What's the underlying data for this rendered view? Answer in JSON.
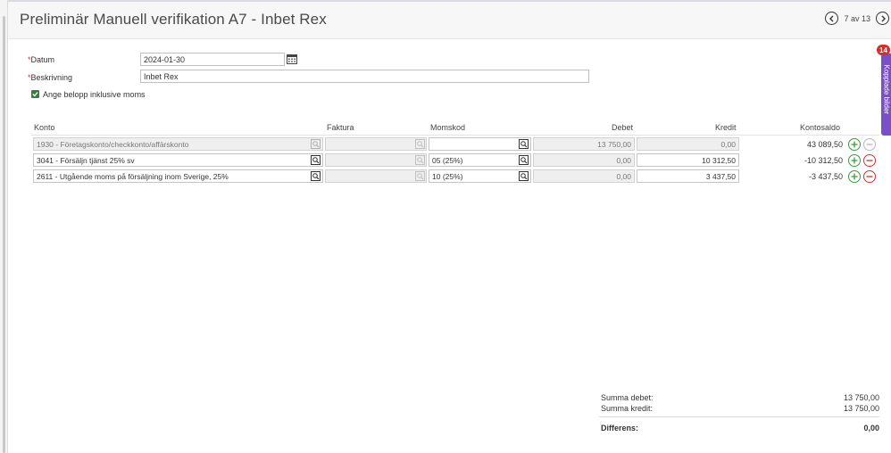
{
  "header": {
    "title": "Preliminär Manuell verifikation A7  -  Inbet Rex",
    "pager": "7 av 13"
  },
  "side_panel": {
    "badge": "14",
    "tab_label": "Kopplade bilder"
  },
  "form": {
    "datum_label": "Datum",
    "datum_value": "2024-01-30",
    "beskrivning_label": "Beskrivning",
    "beskrivning_value": "Inbet Rex",
    "moms_checkbox_label": "Ange belopp inklusive moms",
    "moms_checked": true
  },
  "table": {
    "headers": {
      "konto": "Konto",
      "faktura": "Faktura",
      "momskod": "Momskod",
      "debet": "Debet",
      "kredit": "Kredit",
      "kontosaldo": "Kontosaldo"
    },
    "rows": [
      {
        "konto": "1930 - Företagskonto/checkkonto/affärskonto",
        "faktura": "",
        "momskod": "",
        "debet": "13 750,00",
        "kredit": "0,00",
        "kontosaldo": "43 089,50"
      },
      {
        "konto": "3041 - Försäljn tjänst 25% sv",
        "faktura": "",
        "momskod": "05 (25%)",
        "debet": "0,00",
        "kredit": "10 312,50",
        "kontosaldo": "-10 312,50"
      },
      {
        "konto": "2611 - Utgående moms på försäljning inom Sverige, 25%",
        "faktura": "",
        "momskod": "10 (25%)",
        "debet": "0,00",
        "kredit": "3 437,50",
        "kontosaldo": "-3 437,50"
      }
    ]
  },
  "summary": {
    "summa_debet_label": "Summa debet:",
    "summa_debet_value": "13 750,00",
    "summa_kredit_label": "Summa kredit:",
    "summa_kredit_value": "13 750,00",
    "differens_label": "Differens:",
    "differens_value": "0,00"
  },
  "colors": {
    "required": "#d0312d",
    "add": "#3a9a3e",
    "remove": "#c8352f",
    "side_tab": "#7b4fc9",
    "checkbox": "#3a7d3f"
  }
}
